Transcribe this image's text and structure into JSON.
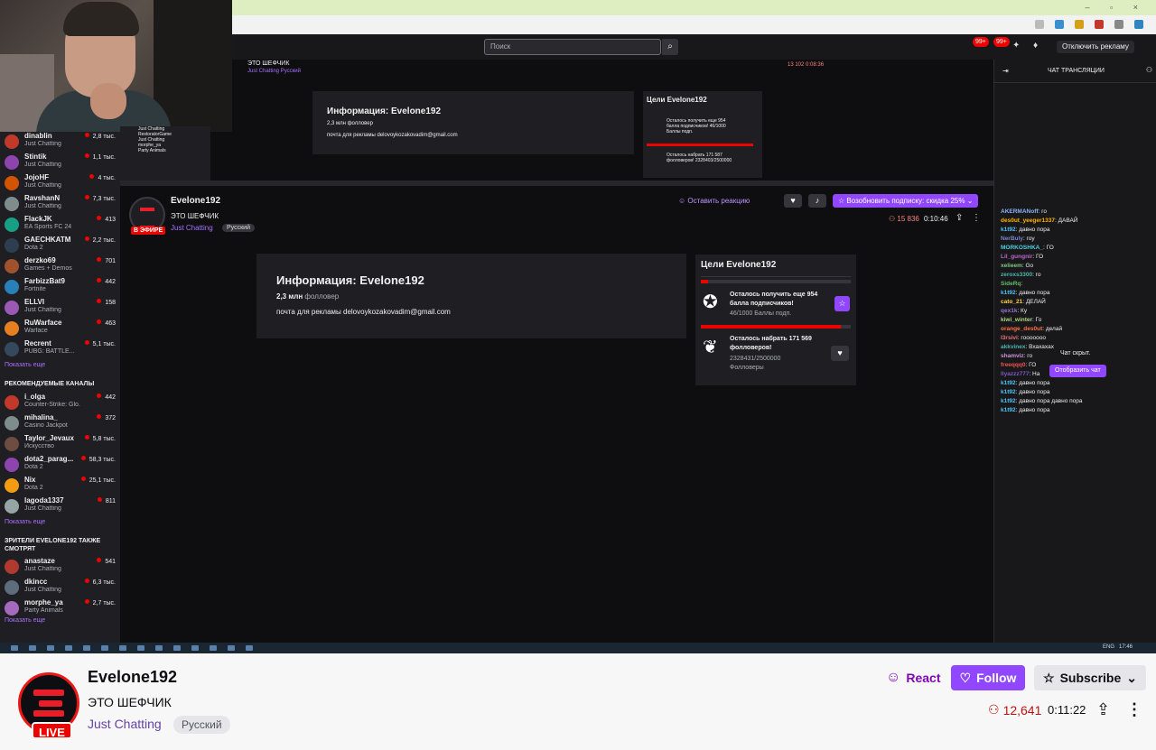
{
  "inner": {
    "search_placeholder": "Поиск",
    "badge1": "99+",
    "badge2": "99+",
    "ads_button": "Отключить рекламу",
    "chat_title": "ЧАТ ТРАНСЛЯЦИИ",
    "mini_title": "ЭТО ШЕФЧИК",
    "mini_category": "Just Chatting   Русский",
    "mini_viewers": "13 102  0:08:36",
    "mini_info_title": "Информация: Evelone192",
    "mini_info_followers": "2,3 млн фолловер",
    "mini_info_email": "почта для рекламы delovoykozakovadim@gmail.com",
    "mini_goals_title": "Цели Evelone192",
    "mini_goal1": "Осталось получить еще 954 балла подписчиков! 46/1000 Баллы подп.",
    "mini_goal2": "Осталось набрать 171 587 фолловеров! 2328403/2500000",
    "mini_sidebar": [
      "Just Chatting",
      "RestoratorGame",
      "Just Chatting",
      "morphe_ya",
      "Party Animals"
    ]
  },
  "sidebar": {
    "channels": [
      {
        "name": "dinablin",
        "category": "Just Chatting",
        "viewers": "2,8 тыс.",
        "color": "#c0392b"
      },
      {
        "name": "Stintik",
        "category": "Just Chatting",
        "viewers": "1,1 тыс.",
        "color": "#8e44ad"
      },
      {
        "name": "JojoHF",
        "category": "Just Chatting",
        "viewers": "4 тыс.",
        "color": "#d35400"
      },
      {
        "name": "RavshanN",
        "category": "Just Chatting",
        "viewers": "7,3 тыс.",
        "color": "#7f8c8d"
      },
      {
        "name": "FlackJK",
        "category": "EA Sports FC 24",
        "viewers": "413",
        "color": "#16a085"
      },
      {
        "name": "GAECHKATM",
        "category": "Dota 2",
        "viewers": "2,2 тыс.",
        "color": "#2c3e50"
      },
      {
        "name": "derzko69",
        "category": "Games + Demos",
        "viewers": "701",
        "color": "#a0522d"
      },
      {
        "name": "FarbizzBat9",
        "category": "Fortnite",
        "viewers": "442",
        "color": "#2980b9"
      },
      {
        "name": "ELLVI",
        "category": "Just Chatting",
        "viewers": "158",
        "color": "#9b59b6"
      },
      {
        "name": "RuWarface",
        "category": "Warface",
        "viewers": "463",
        "color": "#e67e22"
      },
      {
        "name": "Recrent",
        "category": "PUBG: BATTLE...",
        "viewers": "5,1 тыс.",
        "color": "#34495e"
      }
    ],
    "show_more_1": "Показать еще",
    "recommended_heading": "РЕКОМЕНДУЕМЫЕ КАНАЛЫ",
    "recommended": [
      {
        "name": "i_olga",
        "category": "Counter-Strike: Glo...",
        "viewers": "442",
        "color": "#c0392b"
      },
      {
        "name": "mihalina_",
        "category": "Casino Jackpot",
        "viewers": "372",
        "color": "#7f8c8d"
      },
      {
        "name": "Taylor_Jevaux",
        "category": "Искусство",
        "viewers": "5,8 тыс.",
        "color": "#6d4c41"
      },
      {
        "name": "dota2_parag...",
        "category": "Dota 2",
        "viewers": "58,3 тыс.",
        "color": "#8e44ad"
      },
      {
        "name": "Nix",
        "category": "Dota 2",
        "viewers": "25,1 тыс.",
        "color": "#f39c12"
      },
      {
        "name": "lagoda1337",
        "category": "Just Chatting",
        "viewers": "811",
        "color": "#95a5a6"
      }
    ],
    "show_more_2": "Показать еще",
    "also_watch_heading": "ЗРИТЕЛИ EVELONE192 ТАКЖЕ СМОТРЯТ",
    "also_watch": [
      {
        "name": "anastaze",
        "category": "Just Chatting",
        "viewers": "541",
        "color": "#b03a2e"
      },
      {
        "name": "dkincc",
        "category": "Just Chatting",
        "viewers": "6,3 тыс.",
        "color": "#5d6d7e"
      },
      {
        "name": "morphe_ya",
        "category": "Party Animals",
        "viewers": "2,7 тыс.",
        "color": "#a569bd"
      }
    ],
    "show_more_3": "Показать еще"
  },
  "inner_stream": {
    "live": "В ЭФИРЕ",
    "name": "Evelone192",
    "title": "ЭТО ШЕФЧИК",
    "category": "Just Chatting",
    "language": "Русский",
    "react": "Оставить реакцию",
    "subscribe": "Возобновить подписку: скидка 25%",
    "viewers": "15 836",
    "time": "0:10:46",
    "info_title": "Информация: Evelone192",
    "followers_count": "2,3 млн",
    "followers_label": "фолловер",
    "email": "почта для рекламы delovoykozakovadim@gmail.com",
    "goals_title": "Цели Evelone192",
    "goal1_text": "Осталось получить еще 954 балла подписчиков!",
    "goal1_progress": "46/1000 Баллы подп.",
    "goal2_text": "Осталось набрать 171 569 фолловеров!",
    "goal2_progress": "2328431/2500000",
    "goal2_unit": "Фолловеры"
  },
  "chat": {
    "messages": [
      {
        "user": "AKERMANoff",
        "text": ": го",
        "color": "#8ab4f8"
      },
      {
        "user": "des0ut_yeeger1337",
        "text": ": ДАВАЙ",
        "color": "#ffb300"
      },
      {
        "user": "k1t92",
        "text": ": давно пора",
        "color": "#4fc3f7"
      },
      {
        "user": "NerBuly",
        "text": ": гоу",
        "color": "#7986cb"
      },
      {
        "user": "MORKOSHKA_",
        "text": ": ГО",
        "color": "#4dd0e1"
      },
      {
        "user": "Lil_gungnir",
        "text": ": ГО",
        "color": "#ba68c8"
      },
      {
        "user": "xelieem",
        "text": ": Go",
        "color": "#81c784"
      },
      {
        "user": "zeroxs3300",
        "text": ": го",
        "color": "#4db6ac"
      },
      {
        "user": "SideRq",
        "text": ":",
        "color": "#66bb6a"
      },
      {
        "user": "k1t92",
        "text": ": давно пора",
        "color": "#4fc3f7"
      },
      {
        "user": "cato_21",
        "text": ": ДЕЛАЙ",
        "color": "#ffd54f"
      },
      {
        "user": "qex1k",
        "text": ": Ку",
        "color": "#9575cd"
      },
      {
        "user": "kiwi_winter",
        "text": ": Го",
        "color": "#aed581"
      },
      {
        "user": "orange_des0ut",
        "text": ": делай",
        "color": "#ff7043"
      },
      {
        "user": "l3rsivi",
        "text": ": гооооооо",
        "color": "#e57373"
      },
      {
        "user": "akkvinex",
        "text": ": Вхахахах",
        "color": "#4db6ac"
      },
      {
        "user": "shamviz",
        "text": ": го",
        "color": "#ce93d8"
      },
      {
        "user": "freeqqq0",
        "text": ": ГО",
        "color": "#ef5350"
      },
      {
        "user": "llyazzz777",
        "text": ": На",
        "color": "#7e57c2"
      },
      {
        "user": "k1t92",
        "text": ": давно пора",
        "color": "#4fc3f7"
      },
      {
        "user": "k1t92",
        "text": ": давно пора",
        "color": "#4fc3f7"
      },
      {
        "user": "k1t92",
        "text": ": давно пора давно пора",
        "color": "#4fc3f7"
      },
      {
        "user": "k1t92",
        "text": ": давно пора",
        "color": "#4fc3f7"
      }
    ],
    "hidden_label": "Чат скрыт.",
    "show_button": "Отобразить чат"
  },
  "taskbar": {
    "lang": "ENG",
    "clock": "17:46"
  },
  "channel": {
    "name": "Evelone192",
    "live": "LIVE",
    "title": "ЭТО ШЕФЧИК",
    "category": "Just Chatting",
    "language": "Русский",
    "react": "React",
    "follow": "Follow",
    "subscribe": "Subscribe",
    "viewers": "12,641",
    "uptime": "0:11:22"
  },
  "colors": {
    "accent": "#9147ff",
    "live": "#eb0400",
    "viewers": "#bb1411",
    "category": "#6441a5"
  }
}
